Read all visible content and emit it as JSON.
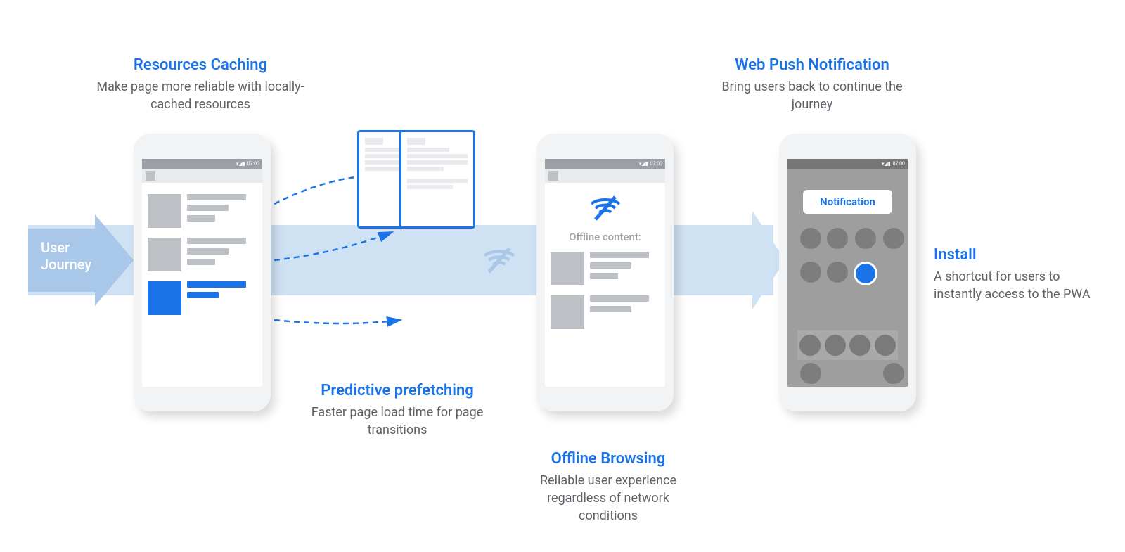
{
  "flow_label": "User\nJourney",
  "captions": {
    "caching": {
      "title": "Resources Caching",
      "desc": "Make page more reliable with locally-cached resources"
    },
    "prefetch": {
      "title": "Predictive prefetching",
      "desc": "Faster page load time for page transitions"
    },
    "offline": {
      "title": "Offline Browsing",
      "desc": "Reliable user experience regardless of network conditions"
    },
    "push": {
      "title": "Web Push Notification",
      "desc": "Bring users back to continue the journey"
    },
    "install": {
      "title": "Install",
      "desc": "A shortcut for users to instantly access to the PWA"
    }
  },
  "phone2": {
    "offline_label": "Offline content:"
  },
  "phone3": {
    "notification_label": "Notification"
  },
  "status": {
    "time": "07:00"
  }
}
